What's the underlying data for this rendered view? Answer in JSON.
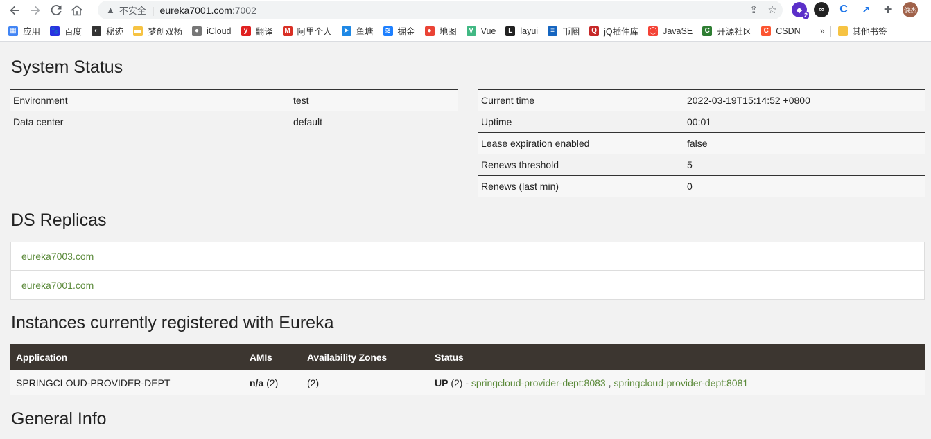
{
  "browser": {
    "address": {
      "security_label": "不安全",
      "host": "eureka7001.com",
      "port": ":7002"
    },
    "bookmarks": [
      {
        "label": "应用",
        "icon": "apps-grid-icon",
        "color": "#4285f4"
      },
      {
        "label": "百度",
        "icon": "baidu-icon",
        "color": "#2932e1"
      },
      {
        "label": "秘迹",
        "icon": "mi-icon",
        "color": "#333333"
      },
      {
        "label": "梦创双杨",
        "icon": "folder-icon",
        "color": "#f6c343"
      },
      {
        "label": "iCloud",
        "icon": "apple-icon",
        "color": "#777777"
      },
      {
        "label": "翻译",
        "icon": "youdao-icon",
        "color": "#e02020"
      },
      {
        "label": "阿里个人",
        "icon": "gmail-icon",
        "color": "#d93025"
      },
      {
        "label": "鱼塘",
        "icon": "arrow-icon",
        "color": "#1e88e5"
      },
      {
        "label": "掘金",
        "icon": "juejin-icon",
        "color": "#1e80ff"
      },
      {
        "label": "地图",
        "icon": "map-pin-icon",
        "color": "#ea4335"
      },
      {
        "label": "Vue",
        "icon": "vue-icon",
        "color": "#41b883"
      },
      {
        "label": "layui",
        "icon": "layui-icon",
        "color": "#222222"
      },
      {
        "label": "币圈",
        "icon": "coin-icon",
        "color": "#1565c0"
      },
      {
        "label": "jQ插件库",
        "icon": "jq-icon",
        "color": "#c62828"
      },
      {
        "label": "JavaSE",
        "icon": "oracle-icon",
        "color": "#f44336"
      },
      {
        "label": "开源社区",
        "icon": "c-icon",
        "color": "#2e7d32"
      },
      {
        "label": "CSDN",
        "icon": "csdn-icon",
        "color": "#fc5531"
      }
    ],
    "more": "»",
    "other_bookmarks": "其他书签",
    "avatar_text": "俊杰",
    "ext_badge": "2"
  },
  "system_status": {
    "title": "System Status",
    "left": [
      {
        "key": "Environment",
        "value": "test"
      },
      {
        "key": "Data center",
        "value": "default"
      }
    ],
    "right": [
      {
        "key": "Current time",
        "value": "2022-03-19T15:14:52 +0800"
      },
      {
        "key": "Uptime",
        "value": "00:01"
      },
      {
        "key": "Lease expiration enabled",
        "value": "false"
      },
      {
        "key": "Renews threshold",
        "value": "5"
      },
      {
        "key": "Renews (last min)",
        "value": "0"
      }
    ]
  },
  "replicas": {
    "title": "DS Replicas",
    "items": [
      "eureka7003.com",
      "eureka7001.com"
    ]
  },
  "instances": {
    "title": "Instances currently registered with Eureka",
    "headers": [
      "Application",
      "AMIs",
      "Availability Zones",
      "Status"
    ],
    "rows": [
      {
        "application": "SPRINGCLOUD-PROVIDER-DEPT",
        "amis_bold": "n/a",
        "amis_count": "(2)",
        "zones": "(2)",
        "status_bold": "UP",
        "status_count": "(2) -",
        "links": [
          "springcloud-provider-dept:8083",
          "springcloud-provider-dept:8081"
        ],
        "link_sep": ","
      }
    ]
  },
  "general_info": {
    "title": "General Info"
  }
}
